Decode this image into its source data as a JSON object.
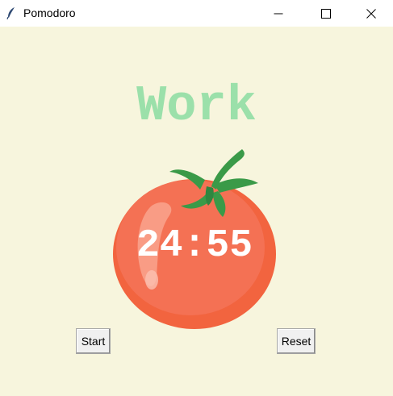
{
  "window": {
    "title": "Pomodoro"
  },
  "label": {
    "text": "Work",
    "color": "#9be0aa"
  },
  "timer": {
    "text": "24:55"
  },
  "buttons": {
    "start_label": "Start",
    "reset_label": "Reset"
  },
  "colors": {
    "background": "#f7f5dd",
    "tomato": "#f2643f",
    "leaf": "#3a9a48"
  },
  "icons": {
    "app": "feather-icon",
    "image": "tomato-icon"
  }
}
